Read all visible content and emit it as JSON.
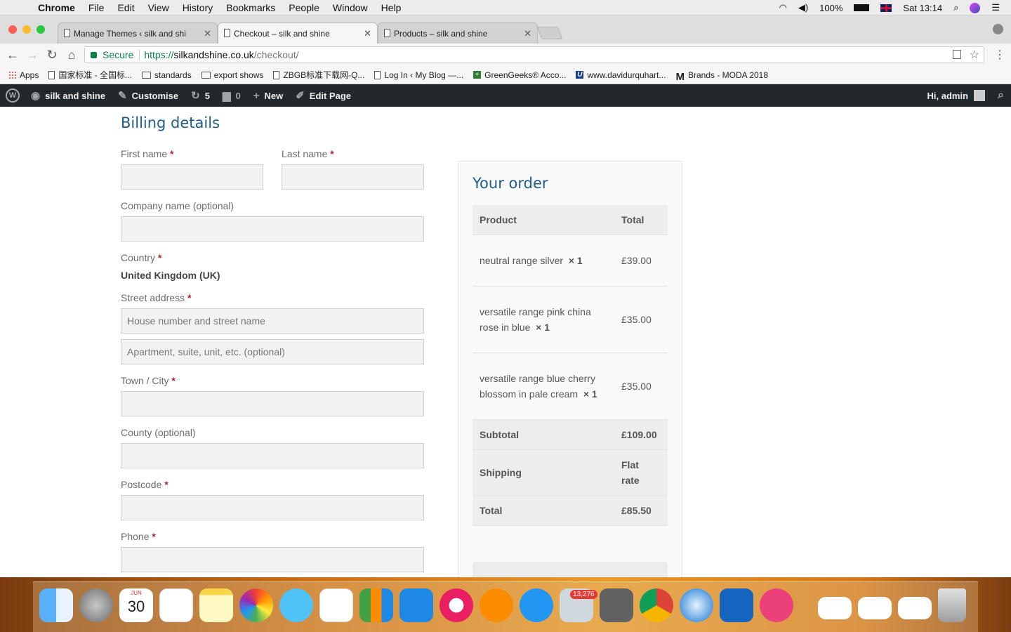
{
  "menubar": {
    "app": "Chrome",
    "items": [
      "File",
      "Edit",
      "View",
      "History",
      "Bookmarks",
      "People",
      "Window",
      "Help"
    ],
    "battery": "100%",
    "clock": "Sat 13:14"
  },
  "tabs": [
    {
      "title": "Manage Themes ‹ silk and shi",
      "active": false
    },
    {
      "title": "Checkout – silk and shine",
      "active": true
    },
    {
      "title": "Products – silk and shine",
      "active": false
    }
  ],
  "address": {
    "secure_label": "Secure",
    "scheme": "https://",
    "host": "silkandshine.co.uk",
    "path": "/checkout/"
  },
  "bookmarks": [
    {
      "label": "Apps",
      "icon": "apps-grid-icon"
    },
    {
      "label": "国家标准 - 全国标...",
      "icon": "page-icon"
    },
    {
      "label": "standards",
      "icon": "folder-icon"
    },
    {
      "label": "export shows",
      "icon": "folder-icon"
    },
    {
      "label": "ZBGB标准下载网-Q...",
      "icon": "page-icon"
    },
    {
      "label": "Log In ‹ My Blog —...",
      "icon": "page-icon"
    },
    {
      "label": "GreenGeeks® Acco...",
      "icon": "greengeeks-icon"
    },
    {
      "label": "www.davidurquhart...",
      "icon": "u-logo-icon"
    },
    {
      "label": "Brands - MODA 2018",
      "icon": "m-logo-icon"
    }
  ],
  "adminbar": {
    "site": "silk and shine",
    "customise": "Customise",
    "updates": "5",
    "comments": "0",
    "new": "New",
    "edit": "Edit Page",
    "greeting": "Hi, admin"
  },
  "billing": {
    "title": "Billing details",
    "first_name": "First name",
    "last_name": "Last name",
    "company": "Company name (optional)",
    "country_label": "Country",
    "country_value": "United Kingdom (UK)",
    "street_label": "Street address",
    "street_placeholder_1": "House number and street name",
    "street_placeholder_2": "Apartment, suite, unit, etc. (optional)",
    "town": "Town / City",
    "county": "County (optional)",
    "postcode": "Postcode",
    "phone": "Phone",
    "required_mark": "*"
  },
  "order": {
    "title": "Your order",
    "col_product": "Product",
    "col_total": "Total",
    "items": [
      {
        "name": "neutral range silver",
        "qty": "× 1",
        "total": "£39.00"
      },
      {
        "name": "versatile range pink china rose in blue",
        "qty": "× 1",
        "total": "£35.00"
      },
      {
        "name": "versatile range blue cherry blossom in pale cream",
        "qty": "× 1",
        "total": "£35.00"
      }
    ],
    "subtotal_label": "Subtotal",
    "subtotal": "£109.00",
    "shipping_label": "Shipping",
    "shipping": "Flat rate",
    "total_label": "Total",
    "total": "£85.50"
  },
  "dock": {
    "calendar_month": "JUN",
    "calendar_day": "30",
    "mail_badge": "13,276"
  }
}
